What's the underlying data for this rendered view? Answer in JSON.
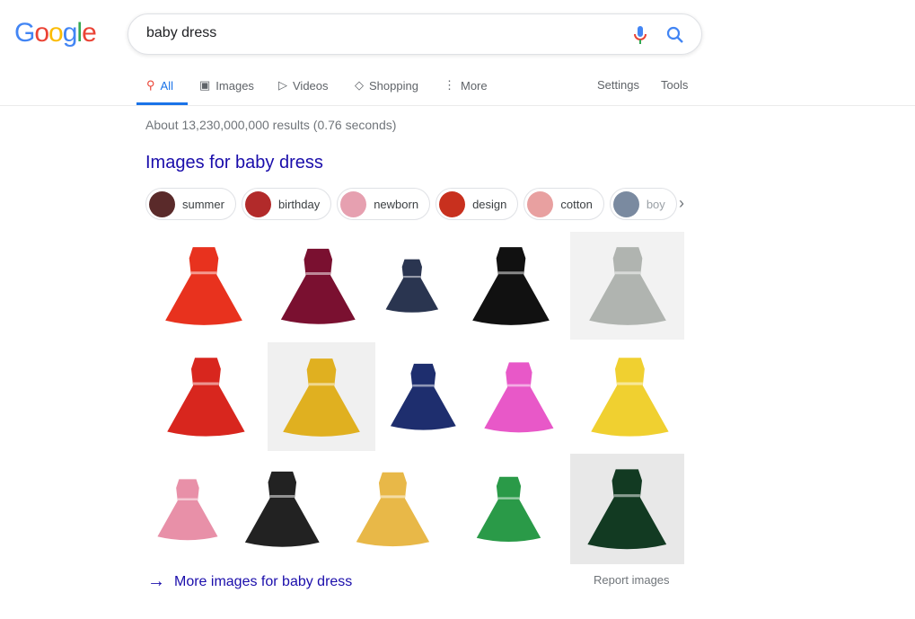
{
  "logo": {
    "text": "Google",
    "letters": [
      {
        "c": "G",
        "color": "#4285f4"
      },
      {
        "c": "o",
        "color": "#ea4335"
      },
      {
        "c": "o",
        "color": "#fbbc05"
      },
      {
        "c": "g",
        "color": "#4285f4"
      },
      {
        "c": "l",
        "color": "#34a853"
      },
      {
        "c": "e",
        "color": "#ea4335"
      }
    ]
  },
  "search": {
    "value": "baby dress",
    "mic_icon": "microphone-icon",
    "search_icon": "search-icon"
  },
  "tabs": [
    {
      "label": "All",
      "icon": "search-icon",
      "active": true
    },
    {
      "label": "Images",
      "icon": "image-icon"
    },
    {
      "label": "Videos",
      "icon": "play-icon"
    },
    {
      "label": "Shopping",
      "icon": "tag-icon"
    },
    {
      "label": "More",
      "icon": "dots-vertical-icon"
    }
  ],
  "tools": {
    "settings": "Settings",
    "tools": "Tools"
  },
  "stats": "About 13,230,000,000 results (0.76 seconds)",
  "images_title": "Images for baby dress",
  "chips": [
    {
      "label": "summer",
      "color": "#5a2a2a"
    },
    {
      "label": "birthday",
      "color": "#b22a2a"
    },
    {
      "label": "newborn",
      "color": "#e6a0b0"
    },
    {
      "label": "design",
      "color": "#c8301e"
    },
    {
      "label": "cotton",
      "color": "#e8a0a0"
    },
    {
      "label": "boy",
      "color": "#7a8aa0"
    }
  ],
  "images": [
    {
      "color": "#e8321e",
      "bg": "#fff"
    },
    {
      "color": "#7a1030",
      "bg": "#fff"
    },
    {
      "color": "#2a3550",
      "bg": "#fff"
    },
    {
      "color": "#111",
      "bg": "#fff"
    },
    {
      "color": "#b0b4b0",
      "bg": "#f2f2f2"
    },
    {
      "color": "#d8261e",
      "bg": "#fff"
    },
    {
      "color": "#e0b020",
      "bg": "#f0f0f0"
    },
    {
      "color": "#1e2e6e",
      "bg": "#fff"
    },
    {
      "color": "#e858c8",
      "bg": "#fff"
    },
    {
      "color": "#f0d030",
      "bg": "#fff"
    },
    {
      "color": "#e890a8",
      "bg": "#fff"
    },
    {
      "color": "#222",
      "bg": "#fff"
    },
    {
      "color": "#e8b848",
      "bg": "#fff"
    },
    {
      "color": "#2a9a48",
      "bg": "#fff"
    },
    {
      "color": "#123a22",
      "bg": "#e8e8e8"
    }
  ],
  "more_images": "More images for baby dress",
  "report_images": "Report images"
}
